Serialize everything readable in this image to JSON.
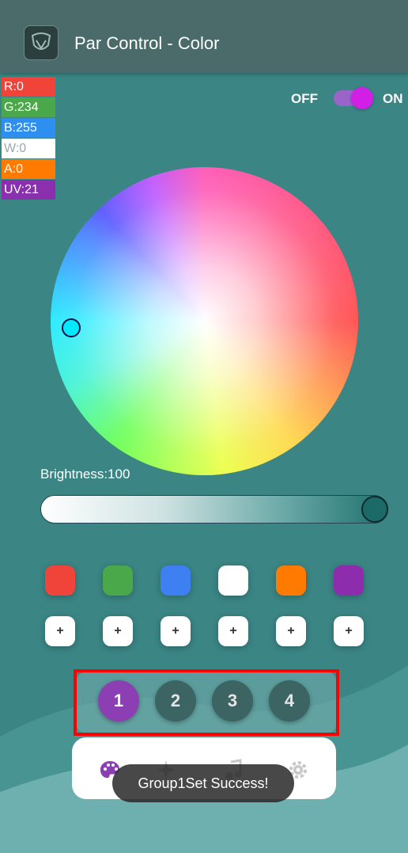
{
  "header": {
    "title": "Par Control - Color"
  },
  "channels": [
    {
      "label": "R:0",
      "color": "#f0433a"
    },
    {
      "label": "G:234",
      "color": "#4aa84a"
    },
    {
      "label": "B:255",
      "color": "#2e8ff0"
    },
    {
      "label": "W:0",
      "color": "#ffffff"
    },
    {
      "label": "A:0",
      "color": "#ff7a00"
    },
    {
      "label": "UV:21",
      "color": "#8a2fae"
    }
  ],
  "power": {
    "off_label": "OFF",
    "on_label": "ON",
    "state": "on"
  },
  "brightness": {
    "label": "Brightness:100",
    "value": 100
  },
  "swatches": [
    "#f0433a",
    "#4aa84a",
    "#3e80f2",
    "#ffffff",
    "#ff7a00",
    "#8e2cae"
  ],
  "add_buttons": [
    "+",
    "+",
    "+",
    "+",
    "+",
    "+"
  ],
  "groups": [
    {
      "label": "1",
      "active": true
    },
    {
      "label": "2",
      "active": false
    },
    {
      "label": "3",
      "active": false
    },
    {
      "label": "4",
      "active": false
    }
  ],
  "tabs": [
    "palette-icon",
    "sparkle-icon",
    "music-note-icon",
    "gear-icon"
  ],
  "toast": "Group1Set Success!"
}
